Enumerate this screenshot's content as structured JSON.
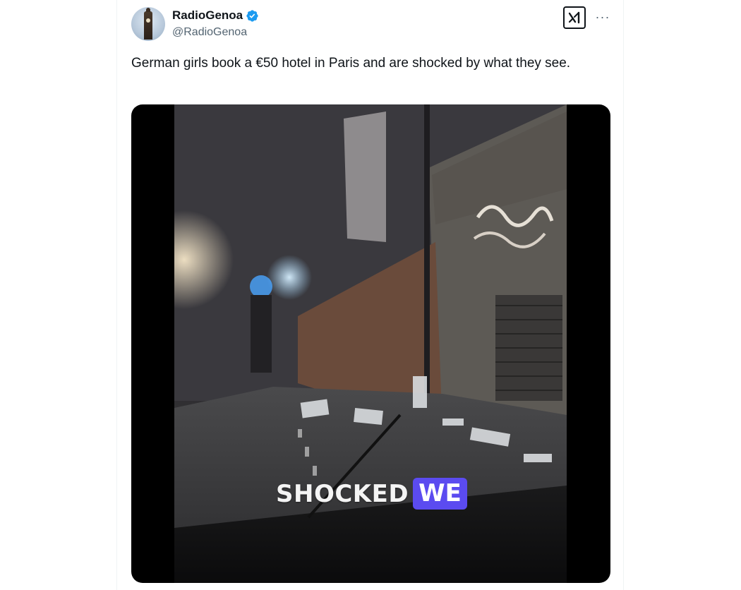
{
  "tweet": {
    "author": {
      "display_name": "RadioGenoa",
      "handle": "@RadioGenoa",
      "verified": true,
      "verified_color": "#1d9bf0"
    },
    "text": "German girls book a €50 hotel in Paris and are shocked by what they see.",
    "actions": {
      "grok_icon": "grok-icon",
      "more_icon": "more-icon",
      "more_label": "···"
    },
    "media": {
      "type": "video",
      "watermark_word": "SHOCKED",
      "watermark_badge": "WE",
      "badge_color": "#5b4bf0"
    }
  }
}
